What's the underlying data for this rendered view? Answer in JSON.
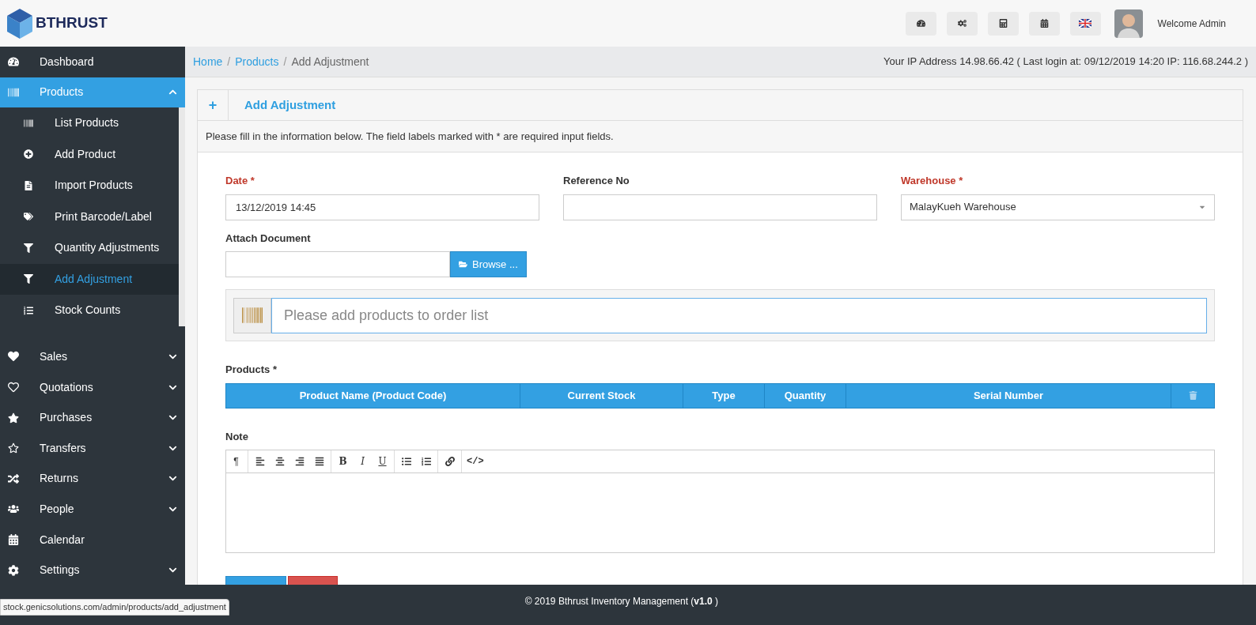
{
  "header": {
    "logo_text": "BTHRUST",
    "welcome": "Welcome Admin"
  },
  "sidebar": {
    "items": [
      {
        "kind": "link",
        "label": "Dashboard",
        "selected": false
      },
      {
        "kind": "menu",
        "label": "Products",
        "selected": true,
        "expanded": true,
        "children": [
          {
            "label": "List Products",
            "selected": false
          },
          {
            "label": "Add Product",
            "selected": false
          },
          {
            "label": "Import Products",
            "selected": false
          },
          {
            "label": "Print Barcode/Label",
            "selected": false
          },
          {
            "label": "Quantity Adjustments",
            "selected": false
          },
          {
            "label": "Add Adjustment",
            "selected": true
          },
          {
            "label": "Stock Counts",
            "selected": false
          }
        ]
      },
      {
        "kind": "menu",
        "label": "Sales",
        "selected": false,
        "expanded": false
      },
      {
        "kind": "menu",
        "label": "Quotations",
        "selected": false,
        "expanded": false
      },
      {
        "kind": "menu",
        "label": "Purchases",
        "selected": false,
        "expanded": false
      },
      {
        "kind": "menu",
        "label": "Transfers",
        "selected": false,
        "expanded": false
      },
      {
        "kind": "menu",
        "label": "Returns",
        "selected": false,
        "expanded": false
      },
      {
        "kind": "menu",
        "label": "People",
        "selected": false,
        "expanded": false
      },
      {
        "kind": "link",
        "label": "Calendar",
        "selected": false
      },
      {
        "kind": "menu",
        "label": "Settings",
        "selected": false,
        "expanded": false
      }
    ]
  },
  "breadcrumb": [
    {
      "label": "Home",
      "kind": "link",
      "separator": "/"
    },
    {
      "label": "Products",
      "kind": "link",
      "separator": "/"
    },
    {
      "label": "Add Adjustment",
      "kind": "current"
    }
  ],
  "ip_info": "Your IP Address 14.98.66.42 ( Last login at: 09/12/2019 14:20 IP: 116.68.244.2 )",
  "panel": {
    "icon_text": "+",
    "title": "Add Adjustment",
    "description": "Please fill in the information below. The field labels marked with * are required input fields."
  },
  "fields": [
    {
      "kind": "text",
      "label": "Date *",
      "required": true,
      "value": "13/12/2019 14:45"
    },
    {
      "kind": "text",
      "label": "Reference No",
      "required": false
    },
    {
      "kind": "select",
      "label": "Warehouse *",
      "required": true,
      "value": "MalayKueh Warehouse"
    }
  ],
  "attach": {
    "label": "Attach Document",
    "button": "Browse ..."
  },
  "product_search": {
    "placeholder": "Please add products to order list"
  },
  "products": {
    "label": "Products *",
    "columns": [
      "Product Name (Product Code)",
      "Current Stock",
      "Type",
      "Quantity",
      "Serial Number"
    ]
  },
  "note": {
    "label": "Note",
    "toolbar": [
      {
        "kind": "glyph",
        "label": "¶"
      },
      {
        "kind": "align-left"
      },
      {
        "kind": "align-center"
      },
      {
        "kind": "align-right"
      },
      {
        "kind": "align-justify"
      },
      {
        "kind": "bold",
        "label": "B"
      },
      {
        "kind": "italic",
        "label": "I"
      },
      {
        "kind": "underline",
        "label": "U"
      },
      {
        "kind": "list-ul"
      },
      {
        "kind": "list-ol"
      },
      {
        "kind": "link"
      },
      {
        "kind": "code",
        "label": "</>"
      }
    ]
  },
  "footer": "© 2019 Bthrust Inventory Management (**v1.0** )",
  "status_url": "stock.genicsolutions.com/admin/products/add_adjustment"
}
